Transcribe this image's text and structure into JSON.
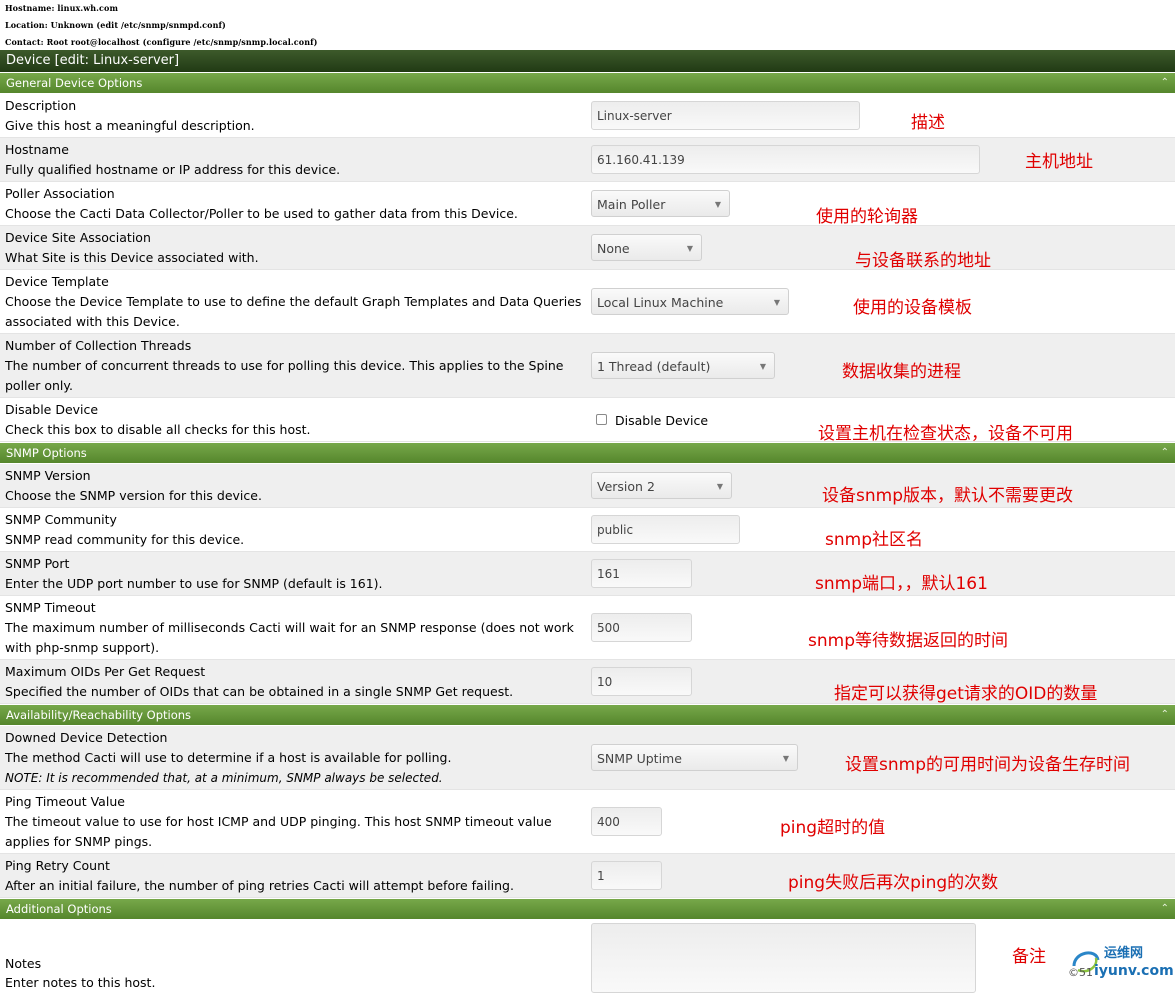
{
  "host_info": {
    "hostname": "Hostname: linux.wh.com",
    "location": "Location: Unknown (edit /etc/snmp/snmpd.conf)",
    "contact": "Contact: Root root@localhost (configure /etc/snmp/snmp.local.conf)"
  },
  "device_title": "Device [edit: Linux-server]",
  "sections": {
    "general": "General Device Options",
    "snmp": "SNMP Options",
    "availability": "Availability/Reachability Options",
    "additional": "Additional Options"
  },
  "fields": {
    "description": {
      "label": "Description",
      "help": "Give this host a meaningful description.",
      "value": "Linux-server",
      "annotation": "描述"
    },
    "hostname": {
      "label": "Hostname",
      "help": "Fully qualified hostname or IP address for this device.",
      "value": "61.160.41.139",
      "annotation": "主机地址"
    },
    "poller": {
      "label": "Poller Association",
      "help": "Choose the Cacti Data Collector/Poller to be used to gather data from this Device.",
      "value": "Main Poller",
      "annotation": "使用的轮询器"
    },
    "site": {
      "label": "Device Site Association",
      "help": "What Site is this Device associated with.",
      "value": "None",
      "annotation": "与设备联系的地址"
    },
    "template": {
      "label": "Device Template",
      "help": "Choose the Device Template to use to define the default Graph Templates and Data Queries associated with this Device.",
      "value": "Local Linux Machine",
      "annotation": "使用的设备模板"
    },
    "threads": {
      "label": "Number of Collection Threads",
      "help": "The number of concurrent threads to use for polling this device. This applies to the Spine poller only.",
      "value": "1 Thread (default)",
      "annotation": "数据收集的进程"
    },
    "disable": {
      "label": "Disable Device",
      "help": "Check this box to disable all checks for this host.",
      "checkbox_label": "Disable Device",
      "checked": false,
      "annotation": "设置主机在检查状态，设备不可用"
    },
    "snmp_version": {
      "label": "SNMP Version",
      "help": "Choose the SNMP version for this device.",
      "value": "Version 2",
      "annotation": "设备snmp版本，默认不需要更改"
    },
    "snmp_community": {
      "label": "SNMP Community",
      "help": "SNMP read community for this device.",
      "value": "public",
      "annotation": "snmp社区名"
    },
    "snmp_port": {
      "label": "SNMP Port",
      "help": "Enter the UDP port number to use for SNMP (default is 161).",
      "value": "161",
      "annotation": "snmp端口，，默认161"
    },
    "snmp_timeout": {
      "label": "SNMP Timeout",
      "help": "The maximum number of milliseconds Cacti will wait for an SNMP response (does not work with php-snmp support).",
      "value": "500",
      "annotation": "snmp等待数据返回的时间"
    },
    "max_oids": {
      "label": "Maximum OIDs Per Get Request",
      "help": "Specified the number of OIDs that can be obtained in a single SNMP Get request.",
      "value": "10",
      "annotation": "指定可以获得get请求的OID的数量"
    },
    "downed": {
      "label": "Downed Device Detection",
      "help": "The method Cacti will use to determine if a host is available for polling.",
      "note": "NOTE: It is recommended that, at a minimum, SNMP always be selected.",
      "value": "SNMP Uptime",
      "annotation": "设置snmp的可用时间为设备生存时间"
    },
    "ping_timeout": {
      "label": "Ping Timeout Value",
      "help": "The timeout value to use for host ICMP and UDP pinging. This host SNMP timeout value applies for SNMP pings.",
      "value": "400",
      "annotation": "ping超时的值"
    },
    "ping_retry": {
      "label": "Ping Retry Count",
      "help": "After an initial failure, the number of ping retries Cacti will attempt before failing.",
      "value": "1",
      "annotation": "ping失败后再次ping的次数"
    },
    "notes": {
      "label": "Notes",
      "help": "Enter notes to this host.",
      "value": "",
      "annotation": "备注"
    }
  },
  "watermark": {
    "brand": "运维网",
    "site": "iyunv.com",
    "prefix": "©51"
  },
  "colors": {
    "annotation": "#e00000",
    "section_green": "#66983a",
    "title_green": "#2d4a1e"
  }
}
